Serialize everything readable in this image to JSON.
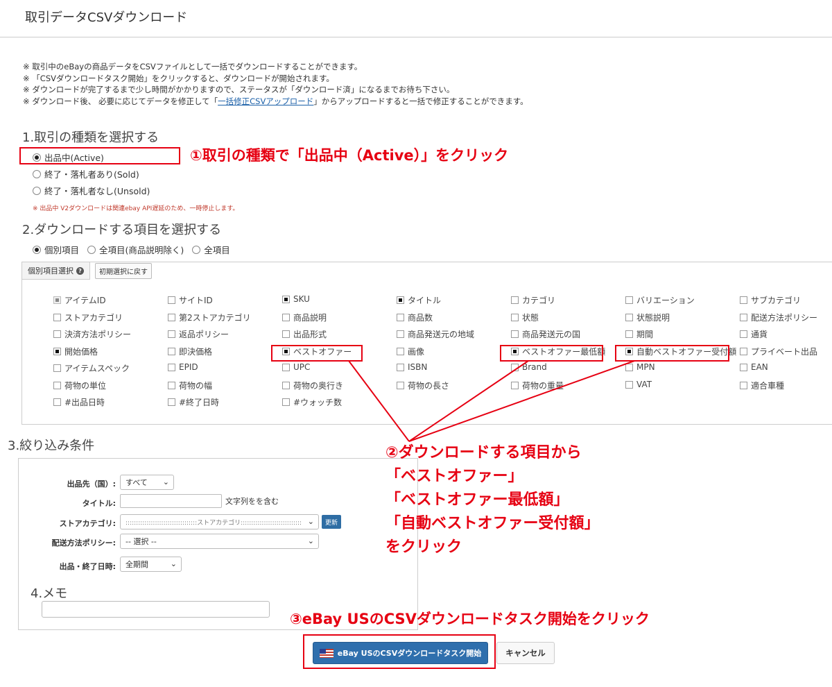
{
  "page": {
    "title": "取引データCSVダウンロード"
  },
  "notes": {
    "line1": "※ 取引中のeBayの商品データをCSVファイルとして一括でダウンロードすることができます。",
    "line2": "※ 「CSVダウンロードタスク開始」をクリックすると、ダウンロードが開始されます。",
    "line3": "※ ダウンロードが完了するまで少し時間がかかりますので、ステータスが「ダウンロード済」になるまでお待ち下さい。",
    "line4_prefix": "※ ダウンロード後、 必要に応じてデータを修正して「",
    "line4_link": "一括修正CSVアップロード",
    "line4_suffix": "」からアップロードすると一括で修正することができます。"
  },
  "section1": {
    "heading": "1.取引の種類を選択する",
    "options": [
      {
        "label": "出品中(Active)",
        "checked": true
      },
      {
        "label": "終了・落札者あり(Sold)",
        "checked": false
      },
      {
        "label": "終了・落札者なし(Unsold)",
        "checked": false
      }
    ],
    "note": "※ 出品中 V2ダウンロードは関連ebay API遅延のため、一時停止します。"
  },
  "section2": {
    "heading": "2.ダウンロードする項目を選択する",
    "scope_options": [
      {
        "label": "個別項目",
        "checked": true
      },
      {
        "label": "全項目(商品説明除く)",
        "checked": false
      },
      {
        "label": "全項目",
        "checked": false
      }
    ],
    "tab_label": "個別項目選択",
    "reset_label": "初期選択に戻す",
    "fields": [
      [
        {
          "label": "アイテムID",
          "checked": true,
          "disabled": true
        },
        {
          "label": "サイトID",
          "checked": false
        },
        {
          "label": "SKU",
          "checked": true
        },
        {
          "label": "タイトル",
          "checked": true
        },
        {
          "label": "カテゴリ",
          "checked": false
        },
        {
          "label": "バリエーション",
          "checked": false
        },
        {
          "label": "サブカテゴリ",
          "checked": false
        }
      ],
      [
        {
          "label": "ストアカテゴリ",
          "checked": false
        },
        {
          "label": "第2ストアカテゴリ",
          "checked": false
        },
        {
          "label": "商品説明",
          "checked": false
        },
        {
          "label": "商品数",
          "checked": false
        },
        {
          "label": "状態",
          "checked": false
        },
        {
          "label": "状態説明",
          "checked": false
        },
        {
          "label": "配送方法ポリシー",
          "checked": false
        }
      ],
      [
        {
          "label": "決済方法ポリシー",
          "checked": false
        },
        {
          "label": "返品ポリシー",
          "checked": false
        },
        {
          "label": "出品形式",
          "checked": false
        },
        {
          "label": "商品発送元の地域",
          "checked": false
        },
        {
          "label": "商品発送元の国",
          "checked": false
        },
        {
          "label": "期間",
          "checked": false
        },
        {
          "label": "通貨",
          "checked": false
        }
      ],
      [
        {
          "label": "開始価格",
          "checked": true
        },
        {
          "label": "即決価格",
          "checked": false
        },
        {
          "label": "ベストオファー",
          "checked": true
        },
        {
          "label": "画像",
          "checked": false
        },
        {
          "label": "ベストオファー最低額",
          "checked": true
        },
        {
          "label": "自動ベストオファー受付額",
          "checked": true
        },
        {
          "label": "プライベート出品",
          "checked": false
        }
      ],
      [
        {
          "label": "アイテムスペック",
          "checked": false
        },
        {
          "label": "EPID",
          "checked": false
        },
        {
          "label": "UPC",
          "checked": false
        },
        {
          "label": "ISBN",
          "checked": false
        },
        {
          "label": "Brand",
          "checked": false
        },
        {
          "label": "MPN",
          "checked": false
        },
        {
          "label": "EAN",
          "checked": false
        }
      ],
      [
        {
          "label": "荷物の単位",
          "checked": false
        },
        {
          "label": "荷物の幅",
          "checked": false
        },
        {
          "label": "荷物の奥行き",
          "checked": false
        },
        {
          "label": "荷物の長さ",
          "checked": false
        },
        {
          "label": "荷物の重量",
          "checked": false
        },
        {
          "label": "VAT",
          "checked": false
        },
        {
          "label": "適合車種",
          "checked": false
        }
      ],
      [
        {
          "label": "#出品日時",
          "checked": false
        },
        {
          "label": "#終了日時",
          "checked": false
        },
        {
          "label": "#ウォッチ数",
          "checked": false
        }
      ]
    ]
  },
  "section3": {
    "heading": "3.絞り込み条件",
    "site_label": "出品先（国）:",
    "site_value": "すべて",
    "title_label": "タイトル:",
    "title_value": "",
    "title_suffix": "文字列をを含む",
    "store_label": "ストアカテゴリ:",
    "store_value": "::::::::::::::::::::::::::::::::::ストアカテゴリ:::::::::::::::::::::::::::::",
    "update_label": "更新",
    "shipping_label": "配送方法ポリシー:",
    "shipping_value": "-- 選択 --",
    "period_label": "出品・終了日時:",
    "period_value": "全期間"
  },
  "section4": {
    "heading": "4.メモ",
    "memo_value": ""
  },
  "actions": {
    "start_label": "eBay USのCSVダウンロードタスク開始",
    "cancel_label": "キャンセル"
  },
  "annotations": {
    "a1": "①取引の種類で「出品中（Active）」をクリック",
    "a2_line1": "②ダウンロードする項目から",
    "a2_line2": "「ベストオファー」",
    "a2_line3": "「ベストオファー最低額」",
    "a2_line4": "「自動ベストオファー受付額」",
    "a2_line5": "をクリック",
    "a3": "③eBay USのCSVダウンロードタスク開始をクリック"
  },
  "colors": {
    "annotation_red": "#e60012",
    "primary_button": "#2f6fad",
    "link": "#1a5fa8"
  }
}
